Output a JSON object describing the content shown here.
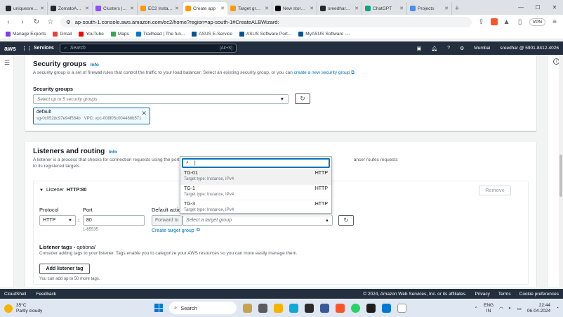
{
  "browser": {
    "tabs": [
      {
        "label": "uniquesreedha",
        "color": "#24292f",
        "active": false
      },
      {
        "label": "ZomatoApp-C",
        "color": "#24292f",
        "active": false
      },
      {
        "label": "Clusters | Elasti",
        "color": "#8c4fff",
        "active": false
      },
      {
        "label": "EC2 Instance C",
        "color": "#ff9900",
        "active": false
      },
      {
        "label": "Create app",
        "color": "#ff9900",
        "active": true
      },
      {
        "label": "Target group d",
        "color": "#ff9900",
        "active": false
      },
      {
        "label": "New story – Me",
        "color": "#000000",
        "active": false
      },
      {
        "label": "sreedhar8897/",
        "color": "#24292f",
        "active": false
      },
      {
        "label": "ChatGPT",
        "color": "#10a37f",
        "active": false
      },
      {
        "label": "Projects",
        "color": "#4a90e2",
        "active": false
      }
    ],
    "url": "ap-south-1.console.aws.amazon.com/ec2/home?region=ap-south-1#CreateALBWizard:",
    "vpn_label": "VPN",
    "bookmarks": [
      {
        "label": "Manage Exports",
        "color": "#7b3fe4"
      },
      {
        "label": "Gmail",
        "color": "#ea4335"
      },
      {
        "label": "YouTube",
        "color": "#ff0000"
      },
      {
        "label": "Maps",
        "color": "#34a853"
      },
      {
        "label": "Trailhead | The fun...",
        "color": "#0176d3"
      },
      {
        "label": "ASUS E-Service",
        "color": "#00539b"
      },
      {
        "label": "ASUS Software Port...",
        "color": "#00539b"
      },
      {
        "label": "MyASUS Software -...",
        "color": "#00539b"
      }
    ]
  },
  "aws_nav": {
    "logo": "aws",
    "services": "Services",
    "search_placeholder": "Search",
    "search_shortcut": "[Alt+S]",
    "region": "Mumbai",
    "account": "sreedhar @ 5901-8412-4026"
  },
  "security_groups": {
    "title": "Security groups",
    "info": "Info",
    "description": "A security group is a set of firewall rules that control the traffic to your load balancer. Select an existing security group, or you can",
    "create_link": "create a new security group",
    "field_label": "Security groups",
    "select_placeholder": "Select up to 5 security groups",
    "selected": {
      "name": "default",
      "id": "sg-0c052dc97e94f584b",
      "vpc": "VPC: vpc-008f05c004468b571"
    }
  },
  "listeners": {
    "title": "Listeners and routing",
    "info": "Info",
    "description_start": "A listener is a process that checks for connection requests using the port and proto",
    "description_end": "ancer routes requests",
    "description_line2": "to its registered targets.",
    "listener_title": "Listener",
    "listener_name": "HTTP:80",
    "remove_label": "Remove",
    "protocol_label": "Protocol",
    "protocol_value": "HTTP",
    "port_label": "Port",
    "port_value": "80",
    "port_hint": "1-65535",
    "default_action_label": "Default action",
    "forward_to": "Forward to",
    "target_placeholder": "Select a target group",
    "create_target_group": "Create target group",
    "tags_title": "Listener tags",
    "tags_optional": "optional",
    "tags_desc": "Consider adding tags to your listener. Tags enable you to categorize your AWS resources so you can more easily manage them.",
    "add_tag_label": "Add listener tag",
    "tags_limit": "You can add up to 50 more tags."
  },
  "dropdown": {
    "search_value": "",
    "options": [
      {
        "name": "TG-01",
        "protocol": "HTTP",
        "desc": "Target type: Instance, IPv4"
      },
      {
        "name": "TG-1",
        "protocol": "HTTP",
        "desc": "Target type: Instance, IPv4"
      },
      {
        "name": "TG-3",
        "protocol": "HTTP",
        "desc": "Target type: Instance, IPv4"
      }
    ]
  },
  "footer": {
    "cloudshell": "CloudShell",
    "feedback": "Feedback",
    "copyright": "© 2024, Amazon Web Services, Inc. or its affiliates.",
    "privacy": "Privacy",
    "terms": "Terms",
    "cookie": "Cookie preferences"
  },
  "taskbar": {
    "temperature": "35°C",
    "weather": "Partly cloudy",
    "search": "Search",
    "lang1": "ENG",
    "lang2": "IN",
    "time": "22:44",
    "date": "06-04-2024"
  }
}
